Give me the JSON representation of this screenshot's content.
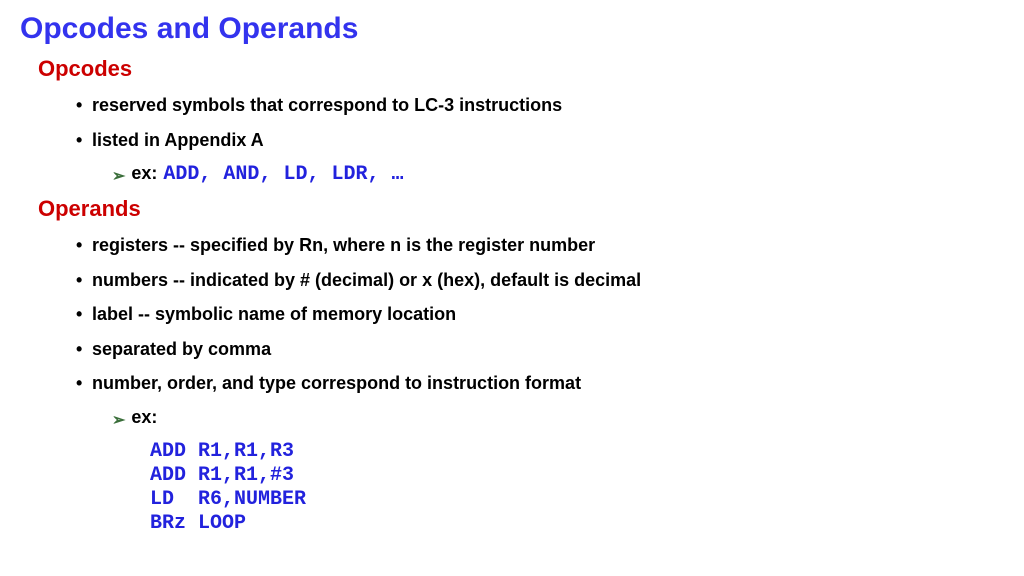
{
  "slide": {
    "title": "Opcodes and Operands"
  },
  "opcodes": {
    "heading": "Opcodes",
    "bullets": [
      "reserved symbols that correspond to LC-3 instructions",
      "listed in Appendix A"
    ],
    "ex_label": "ex:",
    "ex_text": "ADD, AND, LD, LDR, …"
  },
  "operands": {
    "heading": "Operands",
    "bullets": [
      "registers -- specified by Rn, where n is the register number",
      "numbers -- indicated by # (decimal) or x (hex), default is decimal",
      "label -- symbolic name of memory location",
      "separated by comma",
      "number, order, and type correspond to instruction format"
    ],
    "ex_label": "ex:",
    "ex_lines": "ADD R1,R1,R3\nADD R1,R1,#3\nLD  R6,NUMBER\nBRz LOOP"
  },
  "glyphs": {
    "chevron": "➢"
  }
}
